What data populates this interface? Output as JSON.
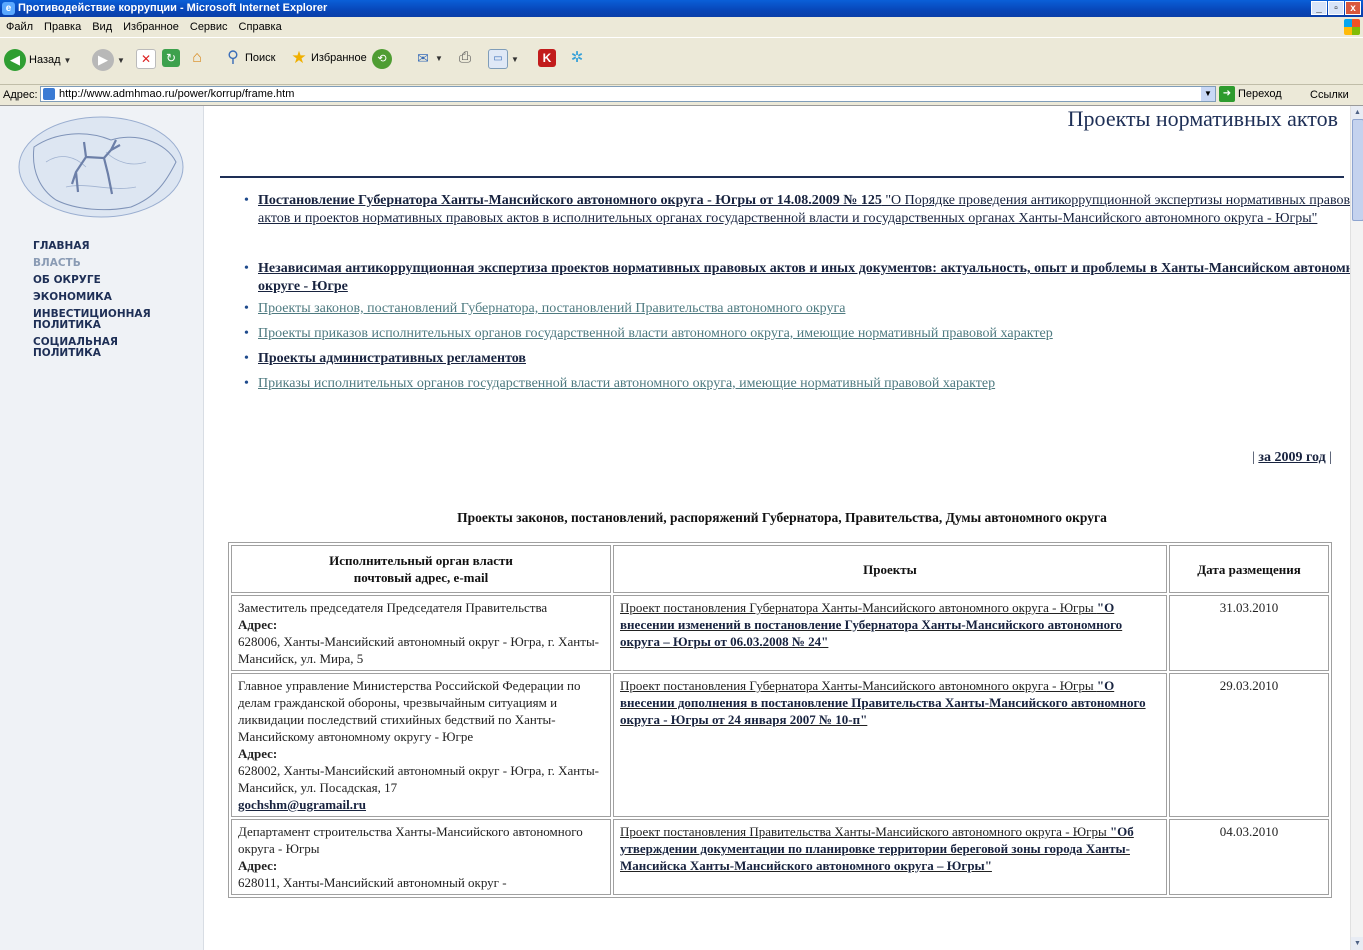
{
  "window": {
    "title": "Противодействие коррупции - Microsoft Internet Explorer"
  },
  "menu": [
    "Файл",
    "Правка",
    "Вид",
    "Избранное",
    "Сервис",
    "Справка"
  ],
  "toolbar": {
    "back": "Назад",
    "search": "Поиск",
    "favorites": "Избранное"
  },
  "address": {
    "label": "Адрес:",
    "url": "http://www.admhmao.ru/power/korrup/frame.htm",
    "go": "Переход",
    "links": "Ссылки"
  },
  "sidebar": {
    "nav": [
      {
        "label": "ГЛАВНАЯ",
        "active": false
      },
      {
        "label": "ВЛАСТЬ",
        "active": true
      },
      {
        "label": "ОБ ОКРУГЕ",
        "active": false
      },
      {
        "label": "ЭКОНОМИКА",
        "active": false
      },
      {
        "label": "ИНВЕСТИЦИОННАЯ ПОЛИТИКА",
        "active": false
      },
      {
        "label": "СОЦИАЛЬНАЯ ПОЛИТИКА",
        "active": false
      }
    ]
  },
  "main": {
    "title": "Проекты нормативных актов",
    "links": [
      {
        "bold": "Постановление Губернатора Ханты-Мансийского автономного округа - Югры от 14.08.2009 № 125",
        "rest": " \"О Порядке проведения антикоррупционной экспертизы нормативных правовых актов и проектов нормативных правовых актов в исполнительных органах государственной власти и государственных органах Ханты-Мансийского автономного округа - Югры\""
      },
      {
        "bold": "Независимая антикоррупционная экспертиза проектов нормативных правовых актов и иных документов: актуальность, опыт и проблемы в Ханты-Мансийском автономном округе - Югре"
      },
      {
        "text": "Проекты законов, постановлений Губернатора, постановлений Правительства автономного округа"
      },
      {
        "text": "Проекты приказов исполнительных органов государственной власти автономного округа, имеющие нормативный правовой характер"
      },
      {
        "bold": "Проекты административных регламентов"
      },
      {
        "text": "Приказы исполнительных органов государственной власти автономного округа, имеющие нормативный правовой характер"
      }
    ],
    "year_pre": "|",
    "year_link": "за 2009 год",
    "year_post": "|",
    "section_title": "Проекты законов, постановлений, распоряжений Губернатора, Правительства, Думы автономного округа",
    "table": {
      "headers": {
        "org_line1": "Исполнительный орган власти",
        "org_line2": "почтовый адрес, e-mail",
        "projects": "Проекты",
        "date": "Дата размещения"
      },
      "rows": [
        {
          "org": "Заместитель председателя Председателя Правительства",
          "addr_label": "Адрес:",
          "addr": "628006, Ханты-Мансийский автономный округ - Югра, г. Ханты-Мансийск, ул. Мира, 5",
          "email": "",
          "proj_plain": "Проект постановления Губернатора Ханты-Мансийского автономного округа - Югры ",
          "proj_bold": "\"О внесении изменений в постановление Губернатора Ханты-Мансийского автономного округа – Югры от 06.03.2008 № 24\"",
          "date": "31.03.2010"
        },
        {
          "org": "Главное управление Министерства Российской Федерации по делам гражданской обороны, чрезвычайным ситуациям и ликвидации последствий стихийных бедствий по Ханты-Мансийскому автономному округу - Югре",
          "addr_label": "Адрес:",
          "addr": "628002, Ханты-Мансийский автономный округ - Югра, г. Ханты-Мансийск, ул. Посадская, 17",
          "email": "gochshm@ugramail.ru",
          "proj_plain": "Проект постановления Губернатора Ханты-Мансийского автономного округа - Югры ",
          "proj_bold": "\"О внесении дополнения в постановление Правительства Ханты-Мансийского автономного округа - Югры от 24 января 2007 № 10-п\"",
          "date": "29.03.2010"
        },
        {
          "org": "Департамент строительства Ханты-Мансийского автономного округа - Югры",
          "addr_label": "Адрес:",
          "addr": "628011, Ханты-Мансийский автономный округ -",
          "email": "",
          "proj_plain": "Проект постановления Правительства Ханты-Мансийского автономного округа - Югры ",
          "proj_bold": "\"Об утверждении документации по планировке территории береговой зоны города Ханты-Мансийска Ханты-Мансийского автономного округа – Югры\"",
          "date": "04.03.2010"
        }
      ]
    }
  }
}
